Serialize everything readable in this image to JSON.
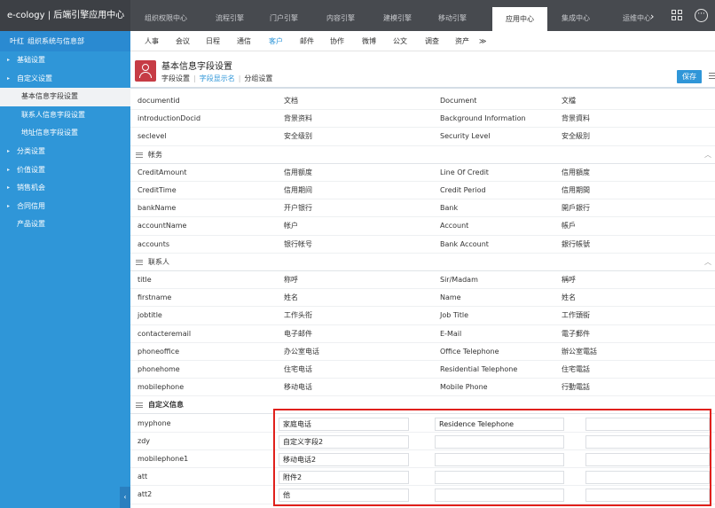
{
  "app": {
    "title": "e-cology | 后端引擎应用中心"
  },
  "top_nav": [
    {
      "label": "组织权限中心",
      "active": false
    },
    {
      "label": "流程引擎",
      "active": false
    },
    {
      "label": "门户引擎",
      "active": false
    },
    {
      "label": "内容引擎",
      "active": false
    },
    {
      "label": "建模引擎",
      "active": false
    },
    {
      "label": "移动引擎",
      "active": false
    },
    {
      "label": "应用中心",
      "active": true
    },
    {
      "label": "集成中心",
      "active": false
    },
    {
      "label": "运维中心",
      "active": false
    }
  ],
  "top_icons": {
    "more": "chevron-right-icon",
    "grid": "grid-icon",
    "options": "more-dots-icon"
  },
  "sidebar": {
    "user": "叶红",
    "org": "组织系统与信息部",
    "items": [
      {
        "label": "基础设置",
        "caret": true,
        "level": 0,
        "selected": false
      },
      {
        "label": "自定义设置",
        "caret": true,
        "level": 0,
        "selected": false,
        "expanded": true
      },
      {
        "label": "基本信息字段设置",
        "caret": false,
        "level": 1,
        "selected": true
      },
      {
        "label": "联系人信息字段设置",
        "caret": false,
        "level": 1,
        "selected": false
      },
      {
        "label": "地址信息字段设置",
        "caret": false,
        "level": 1,
        "selected": false
      },
      {
        "label": "分类设置",
        "caret": true,
        "level": 0,
        "selected": false
      },
      {
        "label": "价值设置",
        "caret": true,
        "level": 0,
        "selected": false
      },
      {
        "label": "销售机会",
        "caret": true,
        "level": 0,
        "selected": false
      },
      {
        "label": "合同信用",
        "caret": true,
        "level": 0,
        "selected": false
      },
      {
        "label": "产品设置",
        "caret": false,
        "level": 0,
        "selected": false
      }
    ],
    "toggle": "‹"
  },
  "sub_nav": [
    {
      "label": "人事",
      "active": false
    },
    {
      "label": "会议",
      "active": false
    },
    {
      "label": "日程",
      "active": false
    },
    {
      "label": "通信",
      "active": false
    },
    {
      "label": "客户",
      "active": true
    },
    {
      "label": "邮件",
      "active": false
    },
    {
      "label": "协作",
      "active": false
    },
    {
      "label": "微博",
      "active": false
    },
    {
      "label": "公文",
      "active": false
    },
    {
      "label": "调查",
      "active": false
    },
    {
      "label": "资产",
      "active": false
    },
    {
      "label": "≫",
      "active": false
    }
  ],
  "page": {
    "title": "基本信息字段设置",
    "tabs": [
      "字段设置",
      "字段显示名",
      "分组设置"
    ],
    "active_tab": 1,
    "save_label": "保存"
  },
  "table": {
    "rows": [
      {
        "type": "row",
        "field": "documentid",
        "zh": "文档",
        "en": "Document",
        "tw": "文檔"
      },
      {
        "type": "row",
        "field": "introductionDocid",
        "zh": "背景资料",
        "en": "Background Information",
        "tw": "背景資料"
      },
      {
        "type": "row",
        "field": "seclevel",
        "zh": "安全级别",
        "en": "Security Level",
        "tw": "安全級別"
      },
      {
        "type": "section",
        "label": "帐务",
        "chevron": true
      },
      {
        "type": "row",
        "field": "CreditAmount",
        "zh": "信用额度",
        "en": "Line Of Credit",
        "tw": "信用額度"
      },
      {
        "type": "row",
        "field": "CreditTime",
        "zh": "信用期间",
        "en": "Credit Period",
        "tw": "信用期間"
      },
      {
        "type": "row",
        "field": "bankName",
        "zh": "开户银行",
        "en": "Bank",
        "tw": "開戶銀行"
      },
      {
        "type": "row",
        "field": "accountName",
        "zh": "帐户",
        "en": "Account",
        "tw": "帳戶"
      },
      {
        "type": "row",
        "field": "accounts",
        "zh": "银行帐号",
        "en": "Bank Account",
        "tw": "銀行帳號"
      },
      {
        "type": "section",
        "label": "联系人",
        "chevron": true
      },
      {
        "type": "row",
        "field": "title",
        "zh": "称呼",
        "en": "Sir/Madam",
        "tw": "稱呼"
      },
      {
        "type": "row",
        "field": "firstname",
        "zh": "姓名",
        "en": "Name",
        "tw": "姓名"
      },
      {
        "type": "row",
        "field": "jobtitle",
        "zh": "工作头衔",
        "en": "Job Title",
        "tw": "工作頭銜"
      },
      {
        "type": "row",
        "field": "contacteremail",
        "zh": "电子邮件",
        "en": "E-Mail",
        "tw": "電子郵件"
      },
      {
        "type": "row",
        "field": "phoneoffice",
        "zh": "办公室电话",
        "en": "Office Telephone",
        "tw": "辦公室電話"
      },
      {
        "type": "row",
        "field": "phonehome",
        "zh": "住宅电话",
        "en": "Residential Telephone",
        "tw": "住宅電話"
      },
      {
        "type": "row",
        "field": "mobilephone",
        "zh": "移动电话",
        "en": "Mobile Phone",
        "tw": "行動電話"
      },
      {
        "type": "section",
        "label": "自定义信息",
        "chevron": false,
        "bold": true
      },
      {
        "type": "input",
        "field": "myphone",
        "zh": "家庭电话",
        "en": "Residence Telephone",
        "tw": ""
      },
      {
        "type": "input",
        "field": "zdy",
        "zh": "自定义字段2",
        "en": "",
        "tw": ""
      },
      {
        "type": "input",
        "field": "mobilephone1",
        "zh": "移动电话2",
        "en": "",
        "tw": ""
      },
      {
        "type": "input",
        "field": "att",
        "zh": "附件2",
        "en": "",
        "tw": ""
      },
      {
        "type": "input",
        "field": "att2",
        "zh": "他",
        "en": "",
        "tw": ""
      }
    ]
  },
  "colors": {
    "topbar": "#474a4f",
    "sidebar": "#2f96d8",
    "accent": "#2f96d8",
    "page_icon": "#c63c45",
    "highlight_border": "#e0201b"
  }
}
